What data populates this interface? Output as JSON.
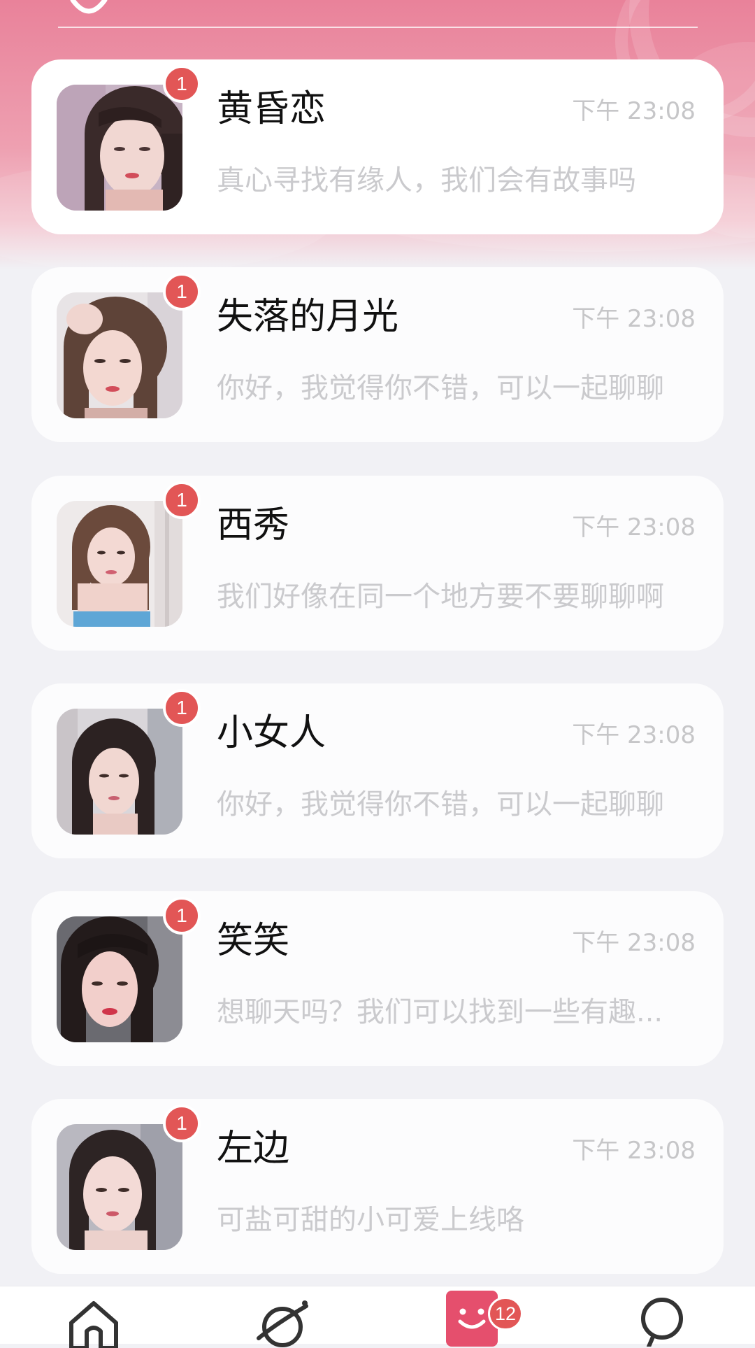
{
  "theme": {
    "accent": "#e54f6d",
    "badge": "#e25656",
    "header_gradient_top": "#e9829a"
  },
  "conversations": [
    {
      "name": "黄昏恋",
      "time": "下午 23:08",
      "preview": "真心寻找有缘人，我们会有故事吗",
      "unread": "1",
      "avatar_icon": "avatar-photo"
    },
    {
      "name": "失落的月光",
      "time": "下午 23:08",
      "preview": "你好，我觉得你不错，可以一起聊聊",
      "unread": "1",
      "avatar_icon": "avatar-photo"
    },
    {
      "name": "西秀",
      "time": "下午 23:08",
      "preview": "我们好像在同一个地方要不要聊聊啊",
      "unread": "1",
      "avatar_icon": "avatar-photo"
    },
    {
      "name": "小女人",
      "time": "下午 23:08",
      "preview": "你好，我觉得你不错，可以一起聊聊",
      "unread": "1",
      "avatar_icon": "avatar-photo"
    },
    {
      "name": "笑笑",
      "time": "下午 23:08",
      "preview": "想聊天吗？我们可以找到一些有趣...",
      "unread": "1",
      "avatar_icon": "avatar-photo"
    },
    {
      "name": "左边",
      "time": "下午 23:08",
      "preview": "可盐可甜的小可爱上线咯",
      "unread": "1",
      "avatar_icon": "avatar-photo"
    }
  ],
  "tabbar": {
    "tabs": [
      {
        "icon": "home-icon",
        "active": false
      },
      {
        "icon": "planet-icon",
        "active": false
      },
      {
        "icon": "message-smile-icon",
        "active": true
      },
      {
        "icon": "profile-icon",
        "active": false
      }
    ],
    "messages_badge": "12"
  }
}
